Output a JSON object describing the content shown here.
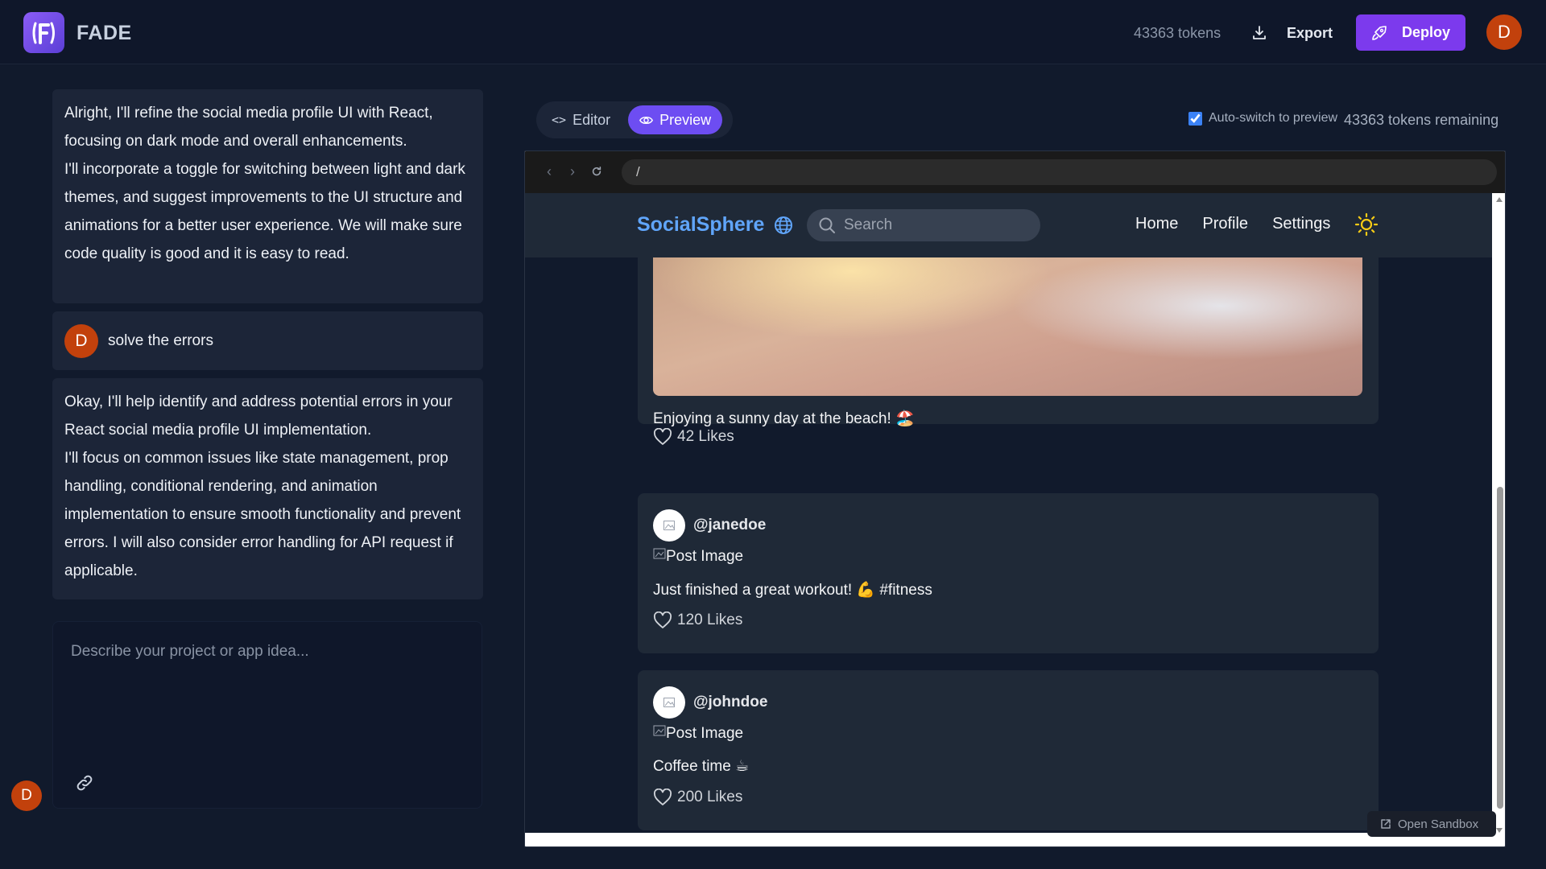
{
  "app": {
    "logo_text": "F",
    "name": "FADE",
    "tokens": "43363 tokens",
    "export_label": "Export",
    "deploy_label": "Deploy",
    "user_initial": "D"
  },
  "chat": {
    "messages": [
      {
        "role": "assistant",
        "lines": [
          "Alright, I'll refine the social media profile UI with React, focusing on dark mode and overall enhancements.",
          "I'll incorporate a toggle for switching between light and dark themes, and suggest improvements to the UI structure and animations for a better user experience. We will make sure code quality is good and it is easy to read."
        ]
      },
      {
        "role": "user",
        "initial": "D",
        "text": "solve the errors"
      },
      {
        "role": "assistant",
        "lines": [
          "Okay, I'll help identify and address potential errors in your React social media profile UI implementation.",
          "I'll focus on common issues like state management, prop handling, conditional rendering, and animation implementation to ensure smooth functionality and prevent errors. I will also consider error handling for API request if applicable."
        ]
      }
    ],
    "input_placeholder": "Describe your project or app idea..."
  },
  "preview_panel": {
    "tabs": [
      {
        "label": "Editor",
        "active": false
      },
      {
        "label": "Preview",
        "active": true
      }
    ],
    "auto_switch_label": "Auto-switch to preview",
    "auto_switch_checked": true,
    "tokens_remaining": "43363 tokens remaining",
    "url": "/",
    "open_sandbox_label": "Open Sandbox"
  },
  "site": {
    "brand": "SocialSphere",
    "search_placeholder": "Search",
    "nav_links": [
      "Home",
      "Profile",
      "Settings"
    ],
    "posts": [
      {
        "username": "",
        "image_alt": "",
        "text": "Enjoying a sunny day at the beach! 🏖️",
        "likes": "42 Likes"
      },
      {
        "username": "@janedoe",
        "image_alt": "Post Image",
        "text": "Just finished a great workout! 💪 #fitness",
        "likes": "120 Likes"
      },
      {
        "username": "@johndoe",
        "image_alt": "Post Image",
        "text": "Coffee time ☕",
        "likes": "200 Likes"
      }
    ]
  },
  "colors": {
    "background": "#111a2c",
    "accent": "#7c3aed",
    "brand_blue": "#60a5fa",
    "avatar": "#c2410c"
  }
}
